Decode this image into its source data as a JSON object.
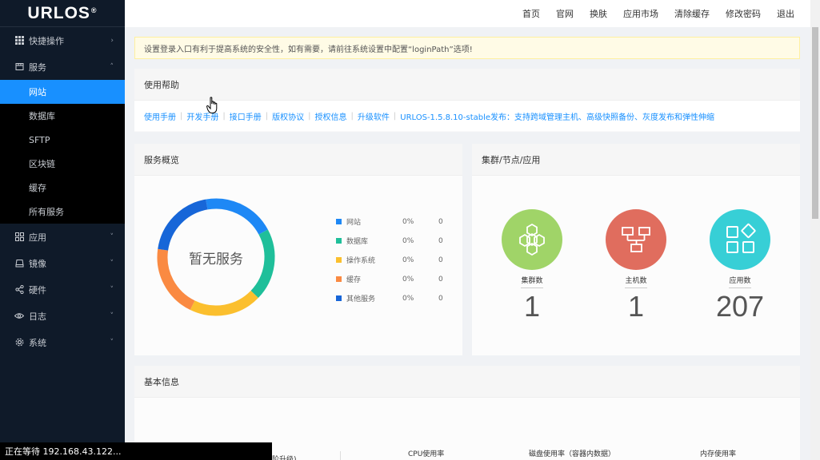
{
  "logo": {
    "text": "URLOS",
    "mark": "®"
  },
  "header": {
    "links": [
      "首页",
      "官网",
      "换肤",
      "应用市场",
      "清除缓存",
      "修改密码",
      "退出"
    ]
  },
  "sidebar": {
    "items": [
      {
        "label": "快捷操作",
        "icon": "grid-icon",
        "chev": "›"
      },
      {
        "label": "服务",
        "icon": "store-icon",
        "chev": "˄"
      },
      {
        "label": "应用",
        "icon": "apps-icon",
        "chev": "˅"
      },
      {
        "label": "镜像",
        "icon": "disk-icon",
        "chev": "˅"
      },
      {
        "label": "硬件",
        "icon": "share-icon",
        "chev": "˅"
      },
      {
        "label": "日志",
        "icon": "eye-icon",
        "chev": "˅"
      },
      {
        "label": "系统",
        "icon": "gear-icon",
        "chev": "˅"
      }
    ],
    "sub_items": [
      "网站",
      "数据库",
      "SFTP",
      "区块链",
      "缓存",
      "所有服务"
    ]
  },
  "alert": {
    "text": "设置登录入口有利于提高系统的安全性，如有需要，请前往系统设置中配置“loginPath”选项!"
  },
  "help": {
    "title": "使用帮助",
    "links": [
      "使用手册",
      "开发手册",
      "接口手册",
      "版权协议",
      "授权信息",
      "升级软件",
      "URLOS-1.5.8.10-stable发布：支持跨域管理主机、高级快照备份、灰度发布和弹性伸缩"
    ]
  },
  "overview": {
    "title": "服务概览",
    "center_text": "暂无服务",
    "legend": [
      {
        "name": "网站",
        "percent": "0%",
        "count": "0",
        "color": "#1e88f5"
      },
      {
        "name": "数据库",
        "percent": "0%",
        "count": "0",
        "color": "#1fbf9a"
      },
      {
        "name": "操作系统",
        "percent": "0%",
        "count": "0",
        "color": "#fbbf2e"
      },
      {
        "name": "缓存",
        "percent": "0%",
        "count": "0",
        "color": "#fa8a42"
      },
      {
        "name": "其他服务",
        "percent": "0%",
        "count": "0",
        "color": "#1766d8"
      }
    ]
  },
  "cluster": {
    "title": "集群/节点/应用",
    "stats": [
      {
        "label": "集群数",
        "value": "1",
        "color": "#a0d468",
        "icon": "hexagon-cluster-icon"
      },
      {
        "label": "主机数",
        "value": "1",
        "color": "#e06d5e",
        "icon": "network-hosts-icon"
      },
      {
        "label": "应用数",
        "value": "207",
        "color": "#37cfd6",
        "icon": "app-blocks-icon"
      }
    ]
  },
  "basic": {
    "title": "基本信息",
    "metrics": [
      "CPU使用率",
      "磁盘使用率（容器内数据）",
      "内存使用率"
    ],
    "partial_left": "阶升级)"
  },
  "status_bar": {
    "text": "正在等待 192.168.43.122..."
  }
}
